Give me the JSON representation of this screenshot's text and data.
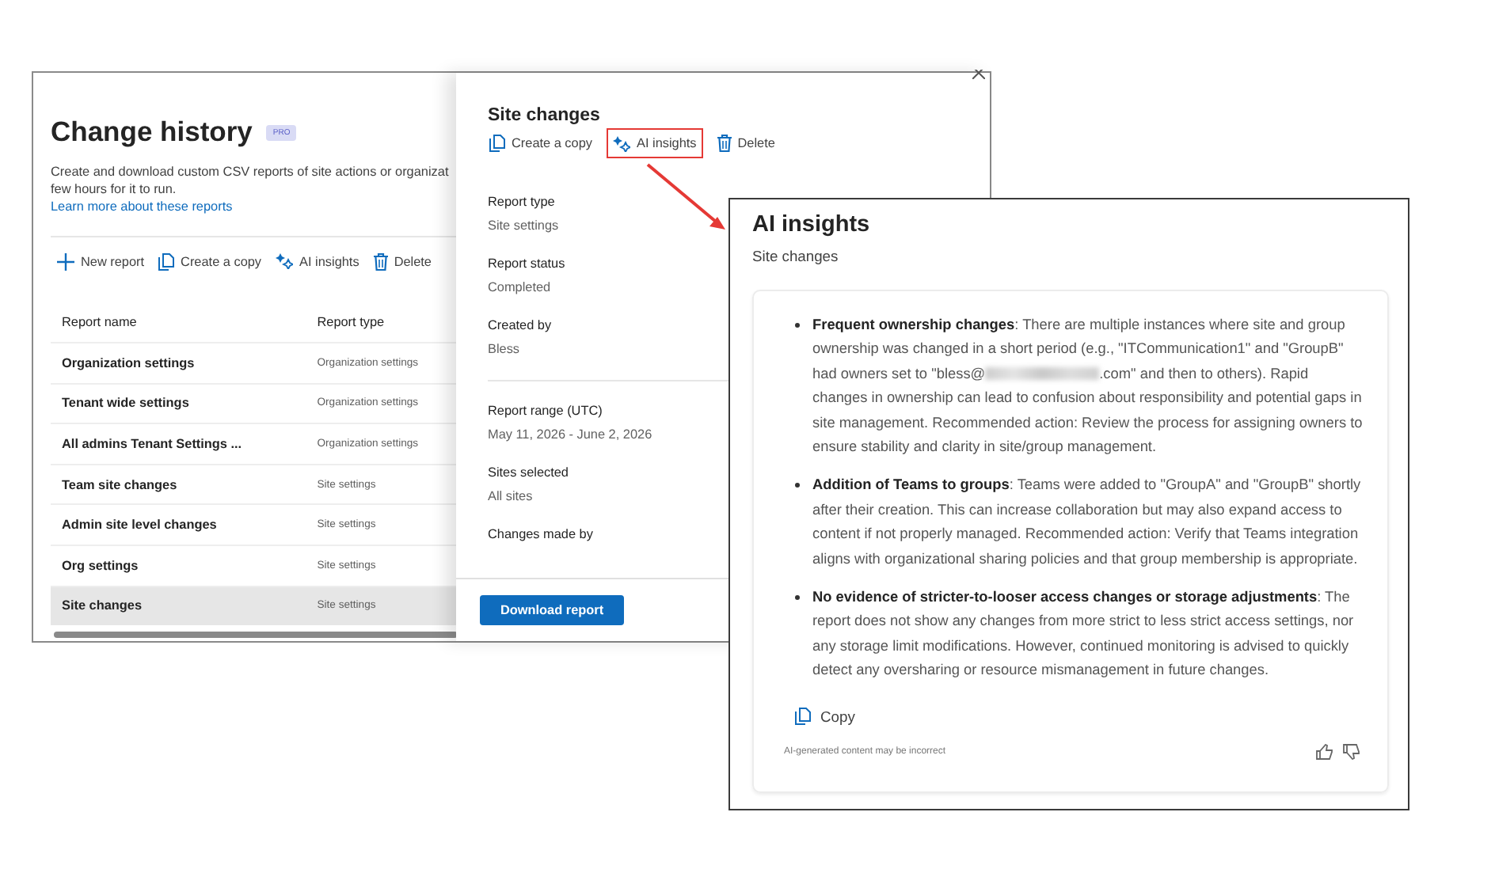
{
  "page": {
    "title": "Change history",
    "badge": "PRO",
    "description_lines": [
      "Create and download custom CSV reports of site actions or organizat",
      "few hours for it to run."
    ],
    "link": "Learn more about these reports",
    "toolbar": [
      {
        "kind": "add",
        "label": "New report"
      },
      {
        "kind": "copy",
        "label": "Create a copy"
      },
      {
        "kind": "ai",
        "label": "AI insights"
      },
      {
        "kind": "delete",
        "label": "Delete"
      }
    ],
    "table": {
      "columns": [
        "Report name",
        "Report type"
      ],
      "rows": [
        {
          "name": "Organization settings",
          "type": "Organization settings",
          "selected": false
        },
        {
          "name": "Tenant wide settings",
          "type": "Organization settings",
          "selected": false
        },
        {
          "name": "All admins Tenant Settings ...",
          "type": "Organization settings",
          "selected": false
        },
        {
          "name": "Team site changes",
          "type": "Site settings",
          "selected": false
        },
        {
          "name": "Admin site level changes",
          "type": "Site settings",
          "selected": false
        },
        {
          "name": "Org settings",
          "type": "Site settings",
          "selected": false
        },
        {
          "name": "Site changes",
          "type": "Site settings",
          "selected": true
        }
      ]
    }
  },
  "panel": {
    "title": "Site changes",
    "actions": [
      {
        "kind": "copy",
        "label": "Create a copy",
        "highlighted": false
      },
      {
        "kind": "ai",
        "label": "AI insights",
        "highlighted": true
      },
      {
        "kind": "delete",
        "label": "Delete",
        "highlighted": false
      }
    ],
    "sections": [
      [
        {
          "label": "Report type",
          "value": "Site settings"
        },
        {
          "label": "Report status",
          "value": "Completed"
        },
        {
          "label": "Created by",
          "value": "Bless"
        }
      ],
      [
        {
          "label": "Report range (UTC)",
          "value": "May 11, 2026 - June 2, 2026"
        },
        {
          "label": "Sites selected",
          "value": "All sites"
        },
        {
          "label": "Changes made by"
        }
      ]
    ],
    "button": "Download report"
  },
  "insights": {
    "title": "AI insights",
    "subtitle": "Site changes",
    "items": [
      {
        "segments": [
          {
            "kind": "text",
            "text": "**Frequent ownership changes**: There are multiple instances where site and group ownership was changed in a short period (e.g., \"ITCommunication1\" and \"GroupB\" had owners set to \"bless@"
          },
          {
            "kind": "blurred"
          },
          {
            "kind": "text",
            "text": ".com\" and then to others). Rapid changes in ownership can lead to confusion about responsibility and potential gaps in site management. Recommended action: Review the process for assigning owners to ensure stability and clarity in site/group management."
          }
        ]
      },
      {
        "segments": [
          {
            "kind": "text",
            "text": "**Addition of Teams to groups**: Teams were added to \"GroupA\" and \"GroupB\" shortly after their creation. This can increase collaboration but may also expand access to content if not properly managed. Recommended action: Verify that Teams integration aligns with organizational sharing policies and that group membership is appropriate."
          }
        ]
      },
      {
        "segments": [
          {
            "kind": "text",
            "text": "**No evidence of stricter-to-looser access changes or storage adjustments**: The report does not show any changes from more strict to less strict access settings, nor any storage limit modifications. However, continued monitoring is advised to quickly detect any oversharing or resource mismanagement in future changes."
          }
        ]
      }
    ],
    "copy": "Copy",
    "disclaimer": "AI-generated content may be incorrect"
  }
}
